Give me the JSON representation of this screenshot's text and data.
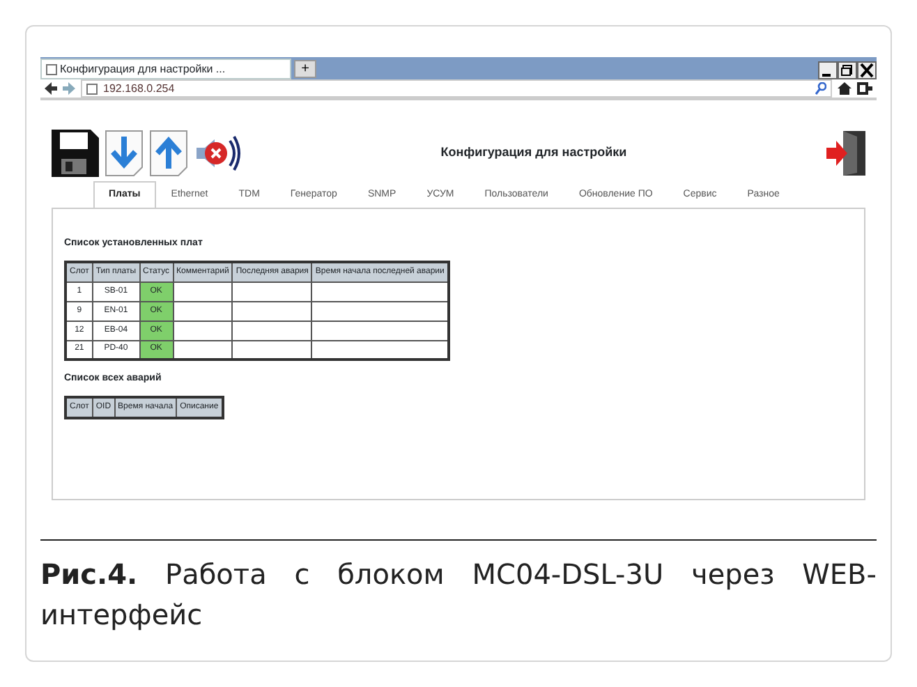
{
  "browser": {
    "tab_title": "Конфигурация для настройки ...",
    "new_tab": "+",
    "address": "192.168.0.254"
  },
  "page": {
    "title": "Конфигурация для настройки",
    "tabs": [
      {
        "label": "Платы",
        "selected": true
      },
      {
        "label": "Ethernet",
        "selected": false
      },
      {
        "label": "TDM",
        "selected": false
      },
      {
        "label": "Генератор",
        "selected": false
      },
      {
        "label": "SNMP",
        "selected": false
      },
      {
        "label": "УСУМ",
        "selected": false
      },
      {
        "label": "Пользователи",
        "selected": false
      },
      {
        "label": "Обновление ПО",
        "selected": false
      },
      {
        "label": "Сервис",
        "selected": false
      },
      {
        "label": "Разное",
        "selected": false
      }
    ],
    "boards_heading": "Список установленных плат",
    "boards_table": {
      "columns": [
        "Слот",
        "Тип платы",
        "Статус",
        "Комментарий",
        "Последняя авария",
        "Время начала последней аварии"
      ],
      "rows": [
        {
          "slot": "1",
          "type": "SB-01",
          "status": "OK",
          "ok": true
        },
        {
          "slot": "9",
          "type": "EN-01",
          "status": "OK",
          "ok": true
        },
        {
          "slot": "12",
          "type": "EB-04",
          "status": "OK",
          "ok": true
        },
        {
          "slot": "21",
          "type": "PD-40",
          "status": "OK",
          "ok": true
        }
      ]
    },
    "alarms_heading": "Список всех аварий",
    "alarms_table": {
      "columns": [
        "Слот",
        "OID",
        "Время начала",
        "Описание"
      ]
    }
  },
  "caption": "**Рис.4.** Работа с блоком MC04-DSL-3U через WEB-интерфейс"
}
